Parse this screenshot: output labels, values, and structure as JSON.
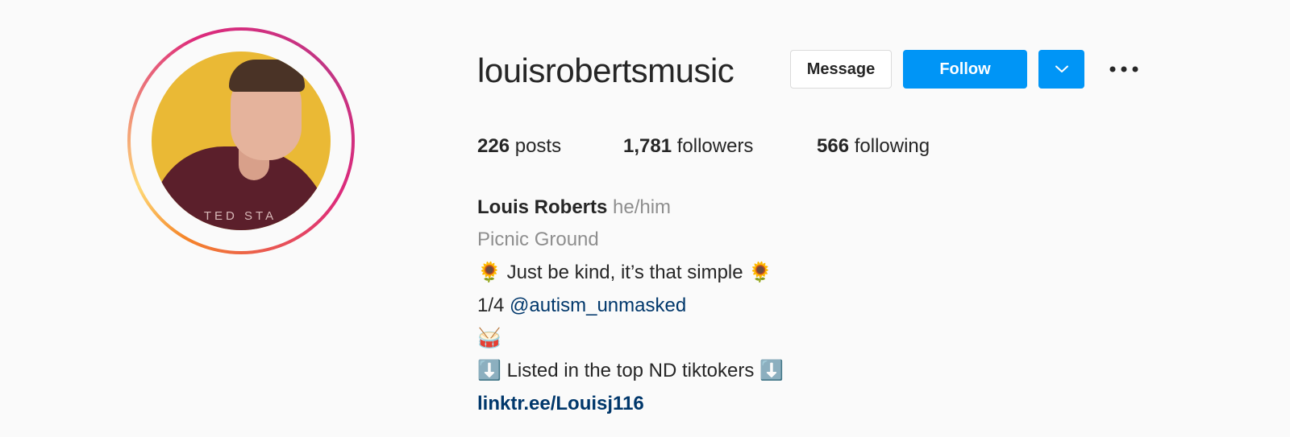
{
  "profile": {
    "username": "louisrobertsmusic",
    "avatar_print_text": "TED STA",
    "buttons": {
      "message": "Message",
      "follow": "Follow"
    },
    "stats": {
      "posts_count": "226",
      "posts_label": "posts",
      "followers_count": "1,781",
      "followers_label": "followers",
      "following_count": "566",
      "following_label": "following"
    },
    "bio": {
      "name": "Louis Roberts",
      "pronouns": "he/him",
      "category": "Picnic Ground",
      "line1_emoji_left": "🌻",
      "line1_text": "Just be kind, it’s that simple",
      "line1_emoji_right": "🌻",
      "line2_prefix": "1/4",
      "line2_mention": "@autism_unmasked",
      "line3_emoji": "🥁",
      "line4_emoji_left": "⬇️",
      "line4_text": "Listed in the top ND tiktokers",
      "line4_emoji_right": "⬇️",
      "link": "linktr.ee/Louisj116"
    }
  },
  "colors": {
    "follow_blue": "#0095f6",
    "link_blue": "#00376b",
    "muted_gray": "#8e8e8e",
    "avatar_yellow": "#eab935",
    "hoodie_maroon": "#5b1f2b"
  },
  "icons": {
    "dropdown": "chevron-down-icon",
    "more": "more-horizontal-icon"
  }
}
